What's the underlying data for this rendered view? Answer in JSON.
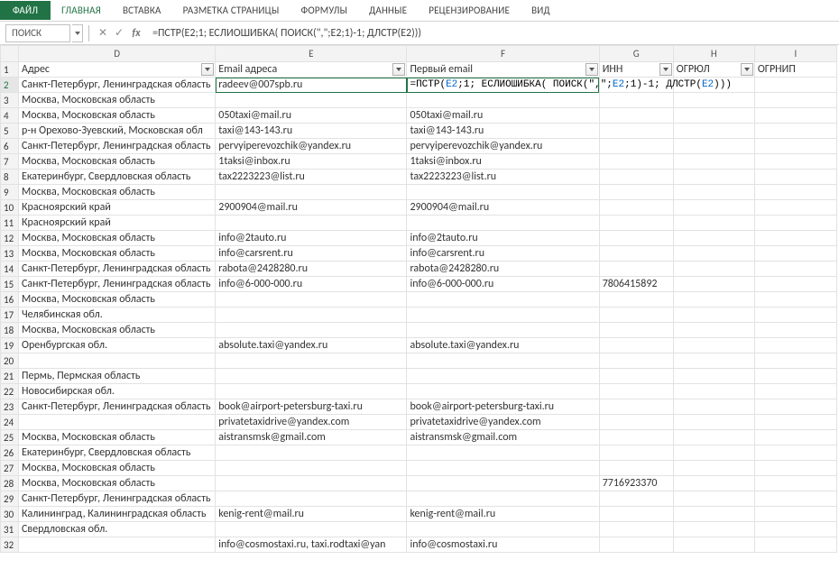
{
  "ribbon": {
    "file": "ФАЙЛ",
    "tabs": [
      "ГЛАВНАЯ",
      "ВСТАВКА",
      "РАЗМЕТКА СТРАНИЦЫ",
      "ФОРМУЛЫ",
      "ДАННЫЕ",
      "РЕЦЕНЗИРОВАНИЕ",
      "ВИД"
    ]
  },
  "namebox": "ПОИСК",
  "formula_bar": "=ПСТР(E2;1; ЕСЛИОШИБКА( ПОИСК(\",\";E2;1)-1; ДЛСТР(E2)))",
  "fx_label": "fx",
  "columns": [
    "D",
    "E",
    "F",
    "G",
    "H",
    "I"
  ],
  "headers": {
    "D": "Адрес",
    "E": "Email адреса",
    "F": "Первый email",
    "G": "ИНН",
    "H": "ОГРЮЛ",
    "I": "ОГРНИП"
  },
  "edit_cell_tokens": [
    {
      "t": "=ПСТР(",
      "c": "fn"
    },
    {
      "t": "E2",
      "c": "ref"
    },
    {
      "t": ";1; ЕСЛИОШИБКА( ПОИСК(\",\";",
      "c": "fn"
    },
    {
      "t": "E2",
      "c": "ref"
    },
    {
      "t": ";1)-1; ДЛСТР(",
      "c": "fn"
    },
    {
      "t": "E2",
      "c": "ref"
    },
    {
      "t": ")))",
      "c": "fn"
    }
  ],
  "rows": [
    {
      "n": 2,
      "D": "Санкт-Петербург, Ленинградская область",
      "E": "radeev@007spb.ru",
      "F_EDIT": true,
      "G": "",
      "H": "",
      "I": ""
    },
    {
      "n": 3,
      "D": "Москва, Московская область",
      "E": "",
      "F": "",
      "G": "",
      "H": "",
      "I": ""
    },
    {
      "n": 4,
      "D": "Москва, Московская область",
      "E": "050taxi@mail.ru",
      "F": "050taxi@mail.ru",
      "G": "",
      "H": "",
      "I": ""
    },
    {
      "n": 5,
      "D": "р-н Орехово-Зуевский, Московская обл",
      "E": "taxi@143-143.ru",
      "F": "taxi@143-143.ru",
      "G": "",
      "H": "",
      "I": ""
    },
    {
      "n": 6,
      "D": "Санкт-Петербург, Ленинградская область",
      "E": "pervyiperevozchik@yandex.ru",
      "F": "pervyiperevozchik@yandex.ru",
      "G": "",
      "H": "",
      "I": ""
    },
    {
      "n": 7,
      "D": "Москва, Московская область",
      "E": "1taksi@inbox.ru",
      "F": "1taksi@inbox.ru",
      "G": "",
      "H": "",
      "I": ""
    },
    {
      "n": 8,
      "D": "Екатеринбург, Свердловская область",
      "E": "tax2223223@list.ru",
      "F": "tax2223223@list.ru",
      "G": "",
      "H": "",
      "I": ""
    },
    {
      "n": 9,
      "D": "Москва, Московская область",
      "E": "",
      "F": "",
      "G": "",
      "H": "",
      "I": ""
    },
    {
      "n": 10,
      "D": "Красноярский край",
      "E": "2900904@mail.ru",
      "F": "2900904@mail.ru",
      "G": "",
      "H": "",
      "I": ""
    },
    {
      "n": 11,
      "D": "Красноярский край",
      "E": "",
      "F": "",
      "G": "",
      "H": "",
      "I": ""
    },
    {
      "n": 12,
      "D": "Москва, Московская область",
      "E": "info@2tauto.ru",
      "F": "info@2tauto.ru",
      "G": "",
      "H": "",
      "I": ""
    },
    {
      "n": 13,
      "D": "Москва, Московская область",
      "E": "info@carsrent.ru",
      "F": "info@carsrent.ru",
      "G": "",
      "H": "",
      "I": ""
    },
    {
      "n": 14,
      "D": "Санкт-Петербург, Ленинградская область",
      "E": "rabota@2428280.ru",
      "F": "rabota@2428280.ru",
      "G": "",
      "H": "",
      "I": ""
    },
    {
      "n": 15,
      "D": "Санкт-Петербург, Ленинградская область",
      "E": "info@6-000-000.ru",
      "F": "info@6-000-000.ru",
      "G": "7806415892",
      "H": "",
      "I": ""
    },
    {
      "n": 16,
      "D": "Москва, Московская область",
      "E": "",
      "F": "",
      "G": "",
      "H": "",
      "I": ""
    },
    {
      "n": 17,
      "D": "Челябинская обл.",
      "E": "",
      "F": "",
      "G": "",
      "H": "",
      "I": ""
    },
    {
      "n": 18,
      "D": "Москва, Московская область",
      "E": "",
      "F": "",
      "G": "",
      "H": "",
      "I": ""
    },
    {
      "n": 19,
      "D": "Оренбургская обл.",
      "E": "absolute.taxi@yandex.ru",
      "F": "absolute.taxi@yandex.ru",
      "G": "",
      "H": "",
      "I": ""
    },
    {
      "n": 20,
      "D": "",
      "E": "",
      "F": "",
      "G": "",
      "H": "",
      "I": ""
    },
    {
      "n": 21,
      "D": "Пермь, Пермская область",
      "E": "",
      "F": "",
      "G": "",
      "H": "",
      "I": ""
    },
    {
      "n": 22,
      "D": "Новосибирская обл.",
      "E": "",
      "F": "",
      "G": "",
      "H": "",
      "I": ""
    },
    {
      "n": 23,
      "D": "Санкт-Петербург, Ленинградская область",
      "E": "book@airport-petersburg-taxi.ru",
      "F": "book@airport-petersburg-taxi.ru",
      "G": "",
      "H": "",
      "I": ""
    },
    {
      "n": 24,
      "D": "",
      "E": "privatetaxidrive@yandex.com",
      "F": "privatetaxidrive@yandex.com",
      "G": "",
      "H": "",
      "I": ""
    },
    {
      "n": 25,
      "D": "Москва, Московская область",
      "E": "aistransmsk@gmail.com",
      "F": "aistransmsk@gmail.com",
      "G": "",
      "H": "",
      "I": ""
    },
    {
      "n": 26,
      "D": "Екатеринбург, Свердловская область",
      "E": "",
      "F": "",
      "G": "",
      "H": "",
      "I": ""
    },
    {
      "n": 27,
      "D": "Москва, Московская область",
      "E": "",
      "F": "",
      "G": "",
      "H": "",
      "I": ""
    },
    {
      "n": 28,
      "D": "Москва, Московская область",
      "E": "",
      "F": "",
      "G": "7716923370",
      "H": "",
      "I": ""
    },
    {
      "n": 29,
      "D": "Санкт-Петербург, Ленинградская область",
      "E": "",
      "F": "",
      "G": "",
      "H": "",
      "I": ""
    },
    {
      "n": 30,
      "D": "Калининград, Калининградская область",
      "E": "kenig-rent@mail.ru",
      "F": "kenig-rent@mail.ru",
      "G": "",
      "H": "",
      "I": ""
    },
    {
      "n": 31,
      "D": "Свердловская обл.",
      "E": "",
      "F": "",
      "G": "",
      "H": "",
      "I": ""
    },
    {
      "n": 32,
      "D": "",
      "E": "info@cosmostaxi.ru, taxi.rodtaxi@yan",
      "F": "info@cosmostaxi.ru",
      "G": "",
      "H": "",
      "I": ""
    }
  ]
}
